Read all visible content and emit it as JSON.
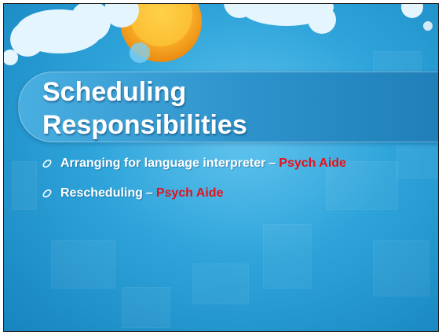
{
  "slide": {
    "title_lines": [
      "Scheduling",
      "Responsibilities"
    ],
    "bullets": [
      {
        "text": "Arranging for language interpreter",
        "separator": "–",
        "role": "Psych Aide"
      },
      {
        "text": "Rescheduling",
        "separator": "–",
        "role": "Psych Aide"
      }
    ],
    "colors": {
      "background": "#2ea4da",
      "title_band": "#2c91ca",
      "text": "#ffffff",
      "role_highlight": "#e8101a",
      "sun": "#f5a623",
      "cloud": "#dff3fd"
    },
    "icons": {
      "bullet": "hollow-oval-bullet-icon",
      "decoration": "sun-and-clouds"
    }
  }
}
